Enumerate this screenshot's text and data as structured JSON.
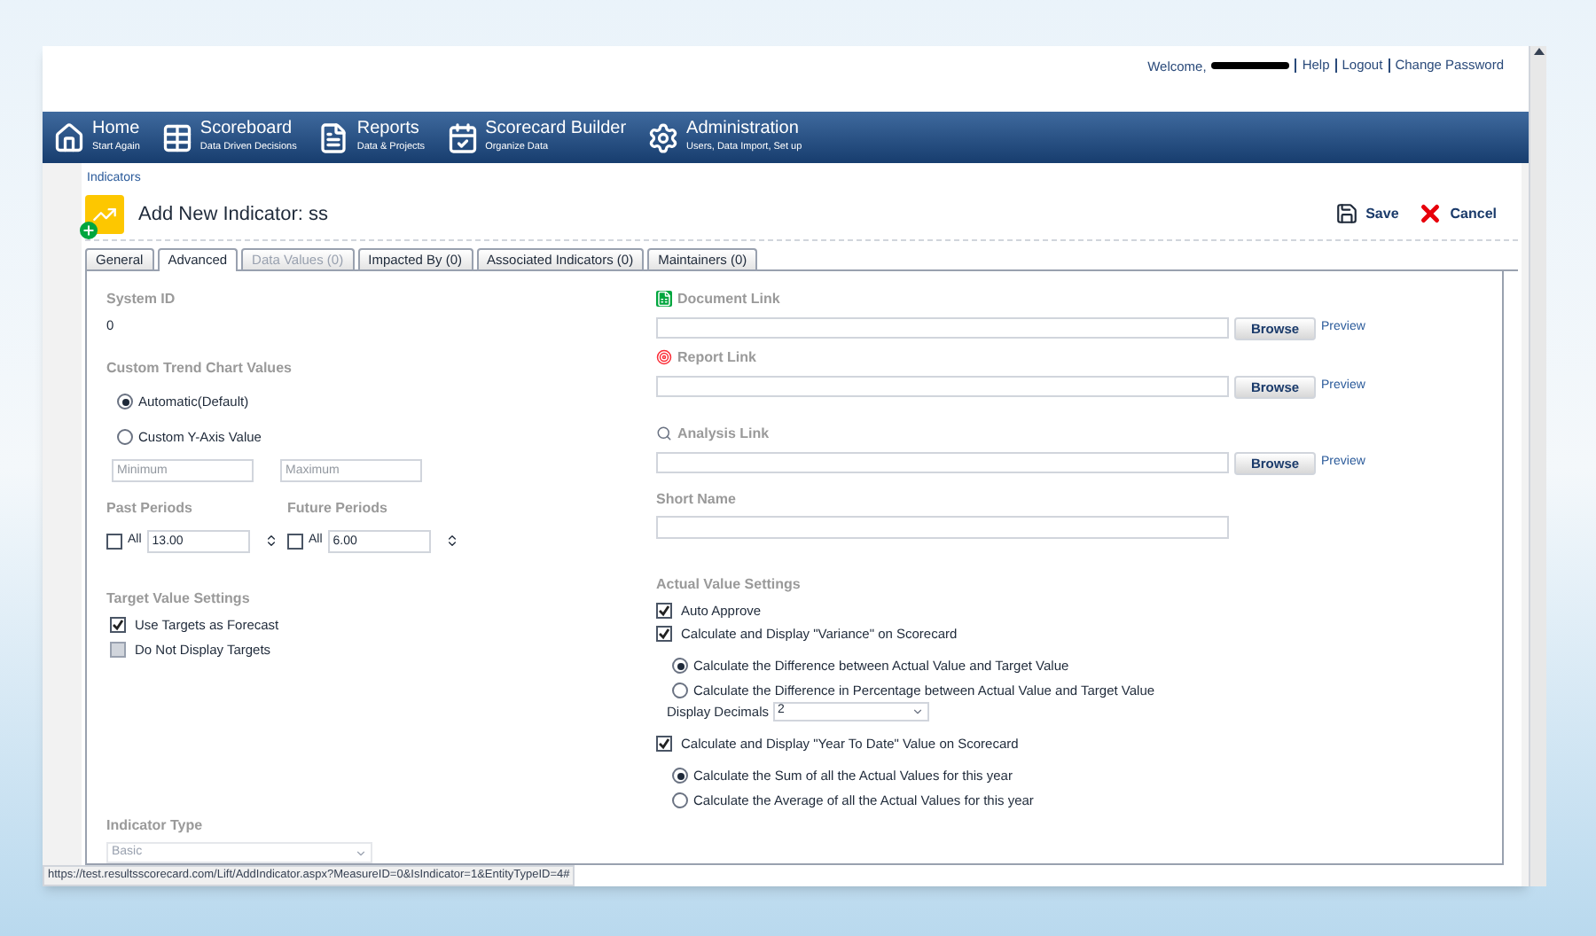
{
  "header": {
    "welcome": "Welcome,",
    "links": [
      "Help",
      "Logout",
      "Change Password"
    ]
  },
  "nav": [
    {
      "kind": "home",
      "title": "Home",
      "subtitle": "Start Again"
    },
    {
      "kind": "scoreboard",
      "title": "Scoreboard",
      "subtitle": "Data Driven Decisions"
    },
    {
      "kind": "reports",
      "title": "Reports",
      "subtitle": "Data & Projects"
    },
    {
      "kind": "builder",
      "title": "Scorecard Builder",
      "subtitle": "Organize Data"
    },
    {
      "kind": "admin",
      "title": "Administration",
      "subtitle": "Users, Data Import, Set up"
    }
  ],
  "breadcrumb": "Indicators",
  "page_title": "Add New Indicator: ss",
  "actions": [
    {
      "kind": "save",
      "label": "Save"
    },
    {
      "kind": "cancel",
      "label": "Cancel"
    }
  ],
  "tabs": [
    {
      "label": "General",
      "selected": false,
      "disabled": false
    },
    {
      "label": "Advanced",
      "selected": true,
      "disabled": false
    },
    {
      "label": "Data Values (0)",
      "selected": false,
      "disabled": true
    },
    {
      "label": "Impacted By (0)",
      "selected": false,
      "disabled": false
    },
    {
      "label": "Associated Indicators (0)",
      "selected": false,
      "disabled": false
    },
    {
      "label": "Maintainers (0)",
      "selected": false,
      "disabled": false
    }
  ],
  "system_id": {
    "label": "System ID",
    "value": "0"
  },
  "trend": {
    "label": "Custom Trend Chart Values",
    "options": [
      {
        "label": "Automatic(Default)",
        "selected": true
      },
      {
        "label": "Custom Y-Axis Value",
        "selected": false
      }
    ],
    "minimum": {
      "placeholder": "Minimum"
    },
    "maximum": {
      "placeholder": "Maximum"
    }
  },
  "periods": [
    {
      "label": "Past Periods",
      "all_label": "All",
      "checked": false,
      "value": "13.00"
    },
    {
      "label": "Future Periods",
      "all_label": "All",
      "checked": false,
      "value": "6.00"
    }
  ],
  "target_settings": {
    "label": "Target Value Settings",
    "options": [
      {
        "label": "Use Targets as Forecast",
        "checked": true,
        "disabled": false
      },
      {
        "label": "Do Not Display Targets",
        "checked": false,
        "disabled": true
      }
    ]
  },
  "indicator_type": {
    "label": "Indicator Type",
    "value": "Basic",
    "disabled": true
  },
  "links": [
    {
      "kind": "document",
      "label": "Document Link",
      "button": "Browse",
      "preview": "Preview"
    },
    {
      "kind": "report",
      "label": "Report Link",
      "button": "Browse",
      "preview": "Preview"
    },
    {
      "kind": "analysis",
      "label": "Analysis Link",
      "button": "Browse",
      "preview": "Preview"
    }
  ],
  "short_name": {
    "label": "Short Name"
  },
  "actual_settings": {
    "label": "Actual Value Settings",
    "items": [
      {
        "kind": "checkbox",
        "label": "Auto Approve",
        "checked": true
      },
      {
        "kind": "checkbox",
        "label": "Calculate and Display \"Variance\" on Scorecard",
        "checked": true
      },
      {
        "kind": "radio",
        "label": "Calculate the Difference between Actual Value and Target Value",
        "selected": true
      },
      {
        "kind": "radio",
        "label": "Calculate the Difference in Percentage between Actual Value and Target Value",
        "selected": false
      },
      {
        "kind": "select",
        "label": "Display Decimals",
        "value": "2"
      },
      {
        "kind": "checkbox",
        "label": "Calculate and Display \"Year To Date\" Value on Scorecard",
        "checked": true
      },
      {
        "kind": "radio",
        "label": "Calculate the Sum of all the Actual Values for this year",
        "selected": true
      },
      {
        "kind": "radio",
        "label": "Calculate the Average of all the Actual Values for this year",
        "selected": false
      }
    ]
  },
  "status_bar": "https://test.resultsscorecard.com/Lift/AddIndicator.aspx?MeasureID=0&IsIndicator=1&EntityTypeID=4#"
}
